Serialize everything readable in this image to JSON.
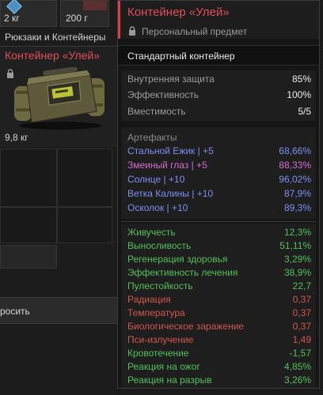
{
  "colors": {
    "accent_red": "#e04f5a",
    "artifact_blue": "#7f8ff0",
    "artifact_pink": "#d36ed0",
    "stat_green": "#54c05c",
    "stat_red": "#d0584e"
  },
  "inventory": {
    "slot_a_weight": "2 кг",
    "slot_b_weight": "200 г",
    "category_title": "Рюкзаки и Контейнеры",
    "selected_item": {
      "name": "Контейнер «Улей»",
      "weight": "9,8 кг",
      "icon": "lock-icon"
    },
    "drop_label": "росить"
  },
  "tooltip": {
    "title": "Контейнер «Улей»",
    "subtitle": "Персональный предмет",
    "subtitle_icon": "lock-icon",
    "type": "Стандартный контейнер",
    "base_stats": [
      {
        "label": "Внутренняя защита",
        "value": "85%"
      },
      {
        "label": "Эффективность",
        "value": "100%"
      },
      {
        "label": "Вместимость",
        "value": "5/5"
      }
    ],
    "artifacts_header": "Артефакты",
    "artifacts": [
      {
        "label": "Стальной Ежик | +5",
        "value": "68,66%",
        "color": "blue"
      },
      {
        "label": "Змеиный глаз | +5",
        "value": "88,33%",
        "color": "pink"
      },
      {
        "label": "Солнце | +10",
        "value": "96,02%",
        "color": "blue"
      },
      {
        "label": "Ветка Калины | +10",
        "value": "87,9%",
        "color": "blue"
      },
      {
        "label": "Осколок | +10",
        "value": "89,3%",
        "color": "blue"
      }
    ],
    "effects": [
      {
        "label": "Живучесть",
        "value": "12,3%",
        "color": "green"
      },
      {
        "label": "Выносливость",
        "value": "51,11%",
        "color": "green"
      },
      {
        "label": "Регенерация здоровья",
        "value": "3,29%",
        "color": "green"
      },
      {
        "label": "Эффективность лечения",
        "value": "38,9%",
        "color": "green"
      },
      {
        "label": "Пулестойкость",
        "value": "22,7",
        "color": "green"
      },
      {
        "label": "Радиация",
        "value": "0,37",
        "color": "red"
      },
      {
        "label": "Температура",
        "value": "0,37",
        "color": "red"
      },
      {
        "label": "Биологическое заражение",
        "value": "0,37",
        "color": "red"
      },
      {
        "label": "Пси-излучение",
        "value": "1,49",
        "color": "red"
      },
      {
        "label": "Кровотечение",
        "value": "-1,57",
        "color": "green"
      },
      {
        "label": "Реакция на ожог",
        "value": "4,85%",
        "color": "green"
      },
      {
        "label": "Реакция на разрыв",
        "value": "3,26%",
        "color": "green"
      }
    ]
  }
}
